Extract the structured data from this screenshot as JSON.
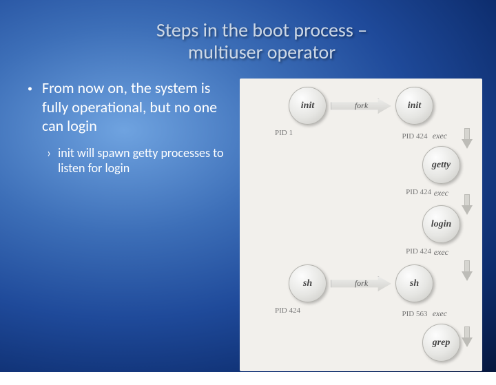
{
  "title": {
    "line1": "Steps in the boot process –",
    "line2": "multiuser operator"
  },
  "body": {
    "bullet": "From now on, the system is fully operational, but no one can login",
    "sub": "init will spawn getty processes to listen for login"
  },
  "diagram": {
    "nodes": {
      "init_left": "init",
      "init_right": "init",
      "getty": "getty",
      "login": "login",
      "sh_left": "sh",
      "sh_right": "sh",
      "grep": "grep"
    },
    "edges": {
      "fork": "fork",
      "exec": "exec"
    },
    "pids": {
      "pid1": "PID 1",
      "pid424": "PID 424",
      "pid563": "PID 563"
    }
  }
}
